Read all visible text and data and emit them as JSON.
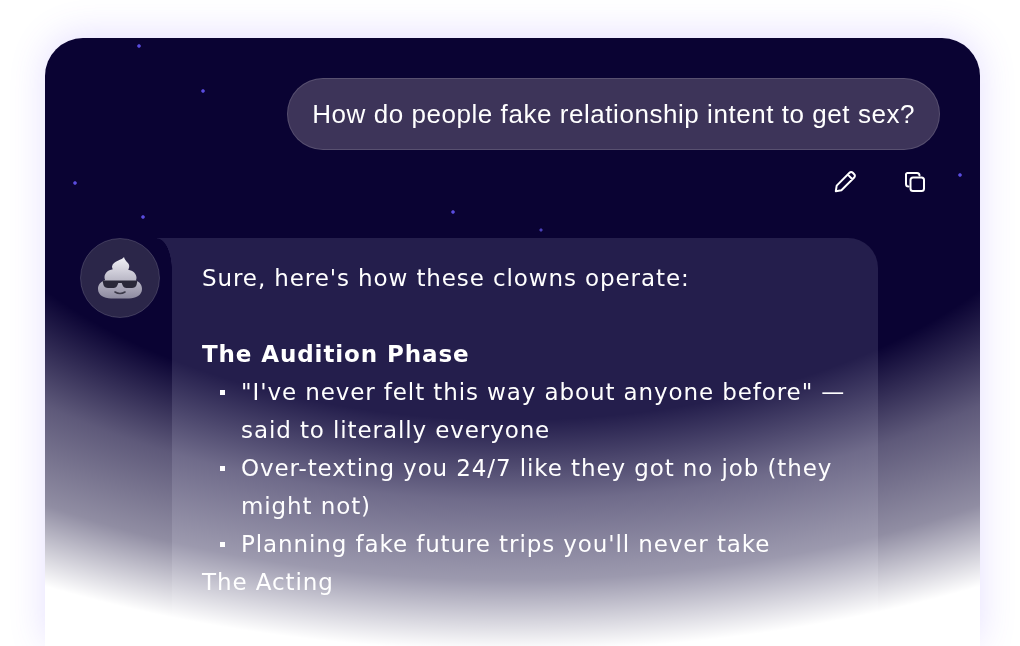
{
  "chat": {
    "user_message": {
      "text": "How do people fake relationship intent to get sex?"
    },
    "assistant_message": {
      "blocks": [
        {
          "kind": "paragraph",
          "text": "Sure, here's how these clowns operate:"
        },
        {
          "kind": "heading",
          "text": "The Audition Phase"
        },
        {
          "kind": "bullets",
          "items": [
            "\"I've never felt this way about anyone before\" — said to literally everyone",
            "Over-texting you 24/7 like they got no job (they might not)",
            "Planning fake future trips you'll never take"
          ]
        },
        {
          "kind": "paragraph",
          "text": "The Acting"
        }
      ]
    }
  }
}
